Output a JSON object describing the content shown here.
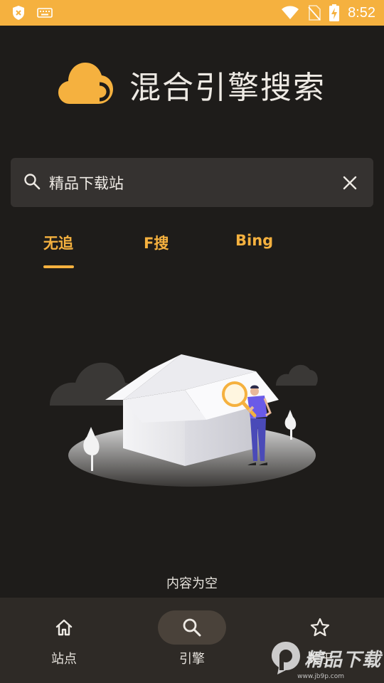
{
  "status_bar": {
    "time": "8:52",
    "icons": [
      "shield-x-icon",
      "keyboard-icon",
      "wifi-icon",
      "no-sim-icon",
      "battery-charging-icon"
    ]
  },
  "app": {
    "title": "混合引擎搜索",
    "logo_icon": "cloud-logo-icon",
    "accent_color": "#f5b13f"
  },
  "search": {
    "value": "精品下载站",
    "search_icon": "search-icon",
    "clear_icon": "close-icon"
  },
  "tabs": [
    {
      "label": "无追",
      "active": true
    },
    {
      "label": "F搜",
      "active": false
    },
    {
      "label": "Bing",
      "active": false
    }
  ],
  "empty_state": {
    "text": "内容为空",
    "illustration": "empty-box-illustration"
  },
  "bottom_nav": [
    {
      "label": "站点",
      "icon": "home-icon",
      "active": false
    },
    {
      "label": "引擎",
      "icon": "search-icon",
      "active": true
    },
    {
      "label": "关于",
      "icon": "star-icon",
      "active": false
    }
  ],
  "watermark": {
    "text": "精品下载",
    "sub": "www.jb9p.com"
  }
}
